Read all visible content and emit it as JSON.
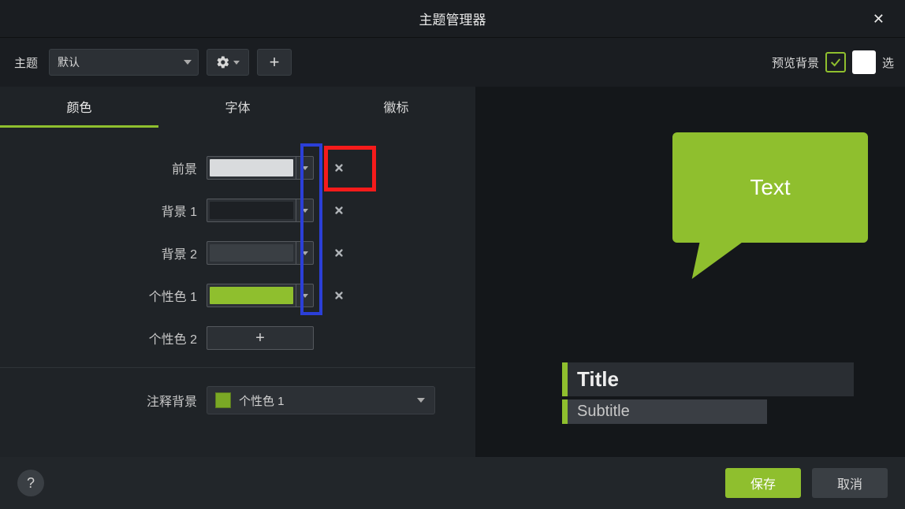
{
  "window": {
    "title": "主题管理器"
  },
  "toolbar": {
    "theme_label": "主题",
    "theme_value": "默认",
    "preview_bg_label": "预览背景",
    "preview_bg_checked": true,
    "preview_bg_color": "#ffffff",
    "trail": "选"
  },
  "tabs": {
    "color": "颜色",
    "font": "字体",
    "logo": "徽标"
  },
  "colors": {
    "foreground_label": "前景",
    "foreground_value": "#d9dbdd",
    "background1_label": "背景 1",
    "background1_value": "#1d2024",
    "background2_label": "背景 2",
    "background2_value": "#3a3f44",
    "accent1_label": "个性色 1",
    "accent1_value": "#8fbf2e",
    "accent2_label": "个性色 2",
    "annotation_bg_label": "注释背景",
    "annotation_bg_value": "个性色 1",
    "annotation_bg_swatch": "#7aa825"
  },
  "preview": {
    "bubble_text": "Text",
    "title": "Title",
    "subtitle": "Subtitle"
  },
  "footer": {
    "help": "?",
    "save": "保存",
    "cancel": "取消"
  }
}
